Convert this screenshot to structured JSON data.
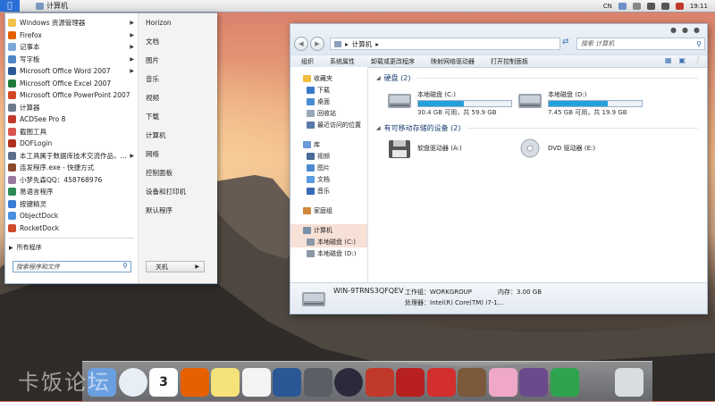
{
  "menubar": {
    "app_label": "计算机",
    "right": {
      "ime": "CN",
      "time": "19:11"
    }
  },
  "start_menu": {
    "programs": [
      {
        "label": "Windows 资源管理器",
        "icon": "folder-icon",
        "color": "#f2c24e",
        "has_arrow": true
      },
      {
        "label": "Firefox",
        "icon": "firefox-icon",
        "color": "#e66000",
        "has_arrow": true
      },
      {
        "label": "记事本",
        "icon": "notepad-icon",
        "color": "#7aa6d8",
        "has_arrow": true
      },
      {
        "label": "写字板",
        "icon": "wordpad-icon",
        "color": "#4f86c6",
        "has_arrow": true
      },
      {
        "label": "Microsoft Office Word 2007",
        "icon": "word-icon",
        "color": "#2b5797",
        "has_arrow": true
      },
      {
        "label": "Microsoft Office Excel 2007",
        "icon": "excel-icon",
        "color": "#1f7a3a",
        "has_arrow": false
      },
      {
        "label": "Microsoft Office PowerPoint 2007",
        "icon": "powerpoint-icon",
        "color": "#d24726",
        "has_arrow": false
      },
      {
        "label": "计算器",
        "icon": "calculator-icon",
        "color": "#6b7b8c",
        "has_arrow": false
      },
      {
        "label": "ACDSee Pro 8",
        "icon": "acdsee-icon",
        "color": "#c0392b",
        "has_arrow": false
      },
      {
        "label": "截图工具",
        "icon": "snipping-icon",
        "color": "#d9534f",
        "has_arrow": false
      },
      {
        "label": "DOFLogin",
        "icon": "dof-icon",
        "color": "#b03020",
        "has_arrow": false
      },
      {
        "label": "本工具属于数据库技术交流作品，...",
        "icon": "tool-icon",
        "color": "#5a6e8a",
        "has_arrow": true
      },
      {
        "label": "连发程序.exe - 快捷方式",
        "icon": "exe-icon",
        "color": "#8a4a2a",
        "has_arrow": false
      },
      {
        "label": "小梦先森QQ：458768976",
        "icon": "qq-icon",
        "color": "#9a7aa0",
        "has_arrow": false
      },
      {
        "label": "易语言程序",
        "icon": "e-lang-icon",
        "color": "#2e8b57",
        "has_arrow": false
      },
      {
        "label": "按键精灵",
        "icon": "key-sprite-icon",
        "color": "#3a7bd5",
        "has_arrow": false
      },
      {
        "label": "ObjectDock",
        "icon": "objectdock-icon",
        "color": "#4a90e2",
        "has_arrow": false
      },
      {
        "label": "RocketDock",
        "icon": "rocketdock-icon",
        "color": "#d04a2a",
        "has_arrow": false
      }
    ],
    "all_programs": "所有程序",
    "search_placeholder": "搜索程序和文件",
    "right_items": [
      "Horizon",
      "文档",
      "图片",
      "音乐",
      "视频",
      "下载",
      "计算机",
      "网络",
      "控制面板",
      "设备和打印机",
      "默认程序"
    ],
    "shutdown_label": "关机"
  },
  "explorer": {
    "address": "计算机",
    "search_placeholder": "搜索 计算机",
    "toolbar": [
      "组织",
      "系统属性",
      "卸载或更改程序",
      "映射网络驱动器",
      "打开控制面板"
    ],
    "nav": {
      "favorites": {
        "label": "收藏夹",
        "items": [
          "下载",
          "桌面",
          "回收站",
          "最近访问的位置"
        ]
      },
      "library": {
        "label": "库",
        "items": [
          "视频",
          "图片",
          "文档",
          "音乐"
        ]
      },
      "homegroup": "家庭组",
      "computer": {
        "label": "计算机",
        "items": [
          "本地磁盘 (C:)",
          "本地磁盘 (D:)"
        ]
      }
    },
    "groups": {
      "hard_disks": "硬盘 (2)",
      "removable": "有可移动存储的设备 (2)"
    },
    "drives": [
      {
        "name": "本地磁盘 (C:)",
        "info": "30.4 GB 可用，共 59.9 GB",
        "used_fraction": 0.49
      },
      {
        "name": "本地磁盘 (D:)",
        "info": "7.45 GB 可用，共 19.9 GB",
        "used_fraction": 0.63
      }
    ],
    "devices": [
      {
        "name": "软盘驱动器 (A:)"
      },
      {
        "name": "DVD 驱动器 (E:)"
      }
    ],
    "details": {
      "computer_name": "WIN-9TRNS3QFQEV",
      "workgroup_label": "工作组：",
      "workgroup": "WORKGROUP",
      "memory_label": "内存：",
      "memory": "3.00 GB",
      "processor_label": "处理器：",
      "processor": "Intel(R) Core(TM) i7-1..."
    }
  },
  "dock": {
    "icons": [
      "finder-icon",
      "safari-icon",
      "calendar-icon",
      "firefox-icon",
      "notes-icon",
      "textedit-icon",
      "word-icon",
      "calculator-icon",
      "camera-icon",
      "acdsee-icon",
      "dnf-icon",
      "dnf-red-icon",
      "game-icon",
      "cat-icon",
      "anime-icon",
      "green-app-icon",
      "trash-icon"
    ],
    "calendar_day": "3"
  },
  "watermark": "卡饭论坛"
}
